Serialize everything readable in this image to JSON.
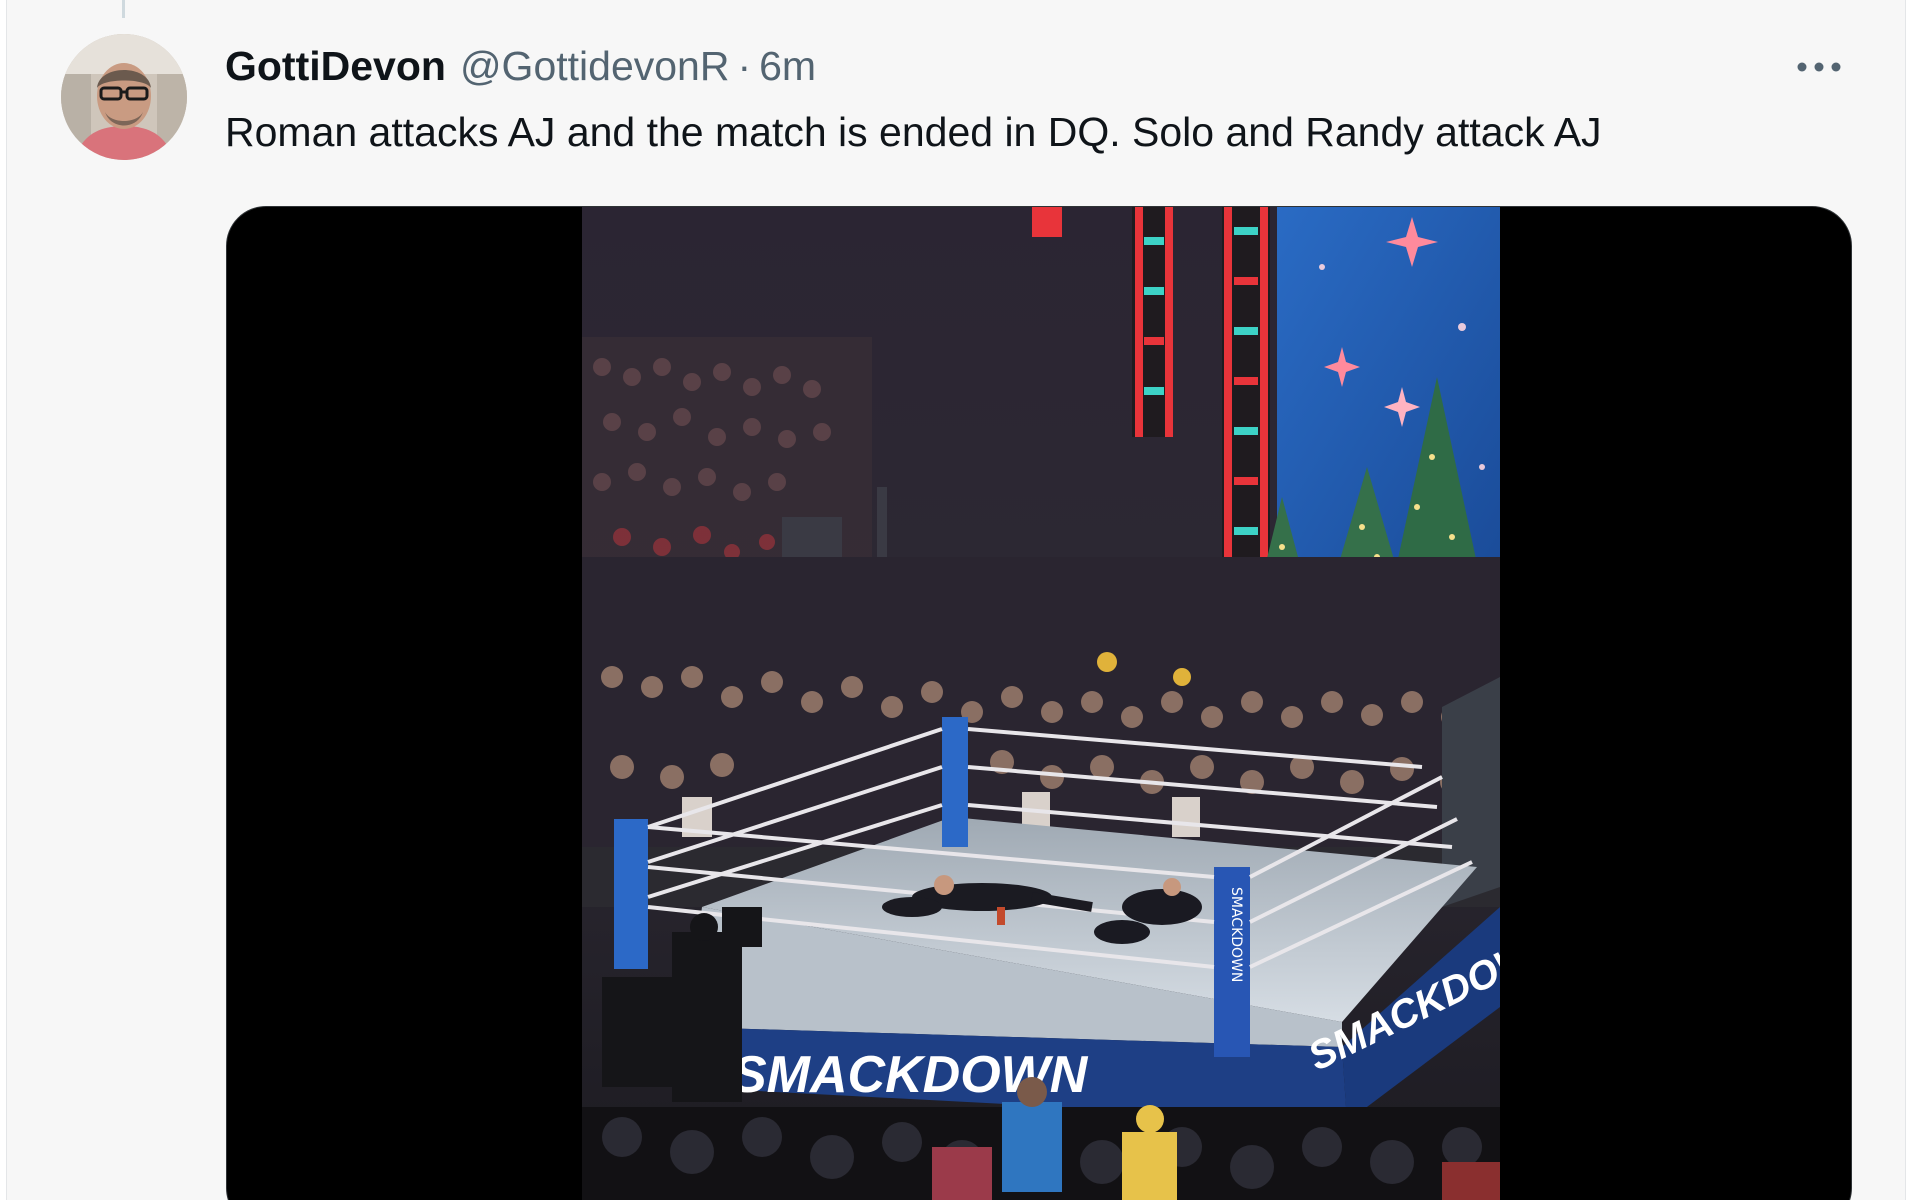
{
  "tweet": {
    "author": {
      "display_name": "GottiDevon",
      "handle": "@GottidevonR",
      "separator": "·",
      "timestamp": "6m"
    },
    "more_icon": "more-horizontal-icon",
    "text": "Roman attacks AJ and the match is ended in DQ. Solo and Randy attack AJ",
    "media": {
      "type": "video",
      "ring_apron_text": "SMACKDOWN",
      "turnbuckle_text": "SMACKDOWN",
      "colors": {
        "letterbox": "#000000",
        "stage_blue": "#1f5fb8",
        "led_red": "#e8343a",
        "mat": "#c9d1db"
      }
    }
  },
  "colors": {
    "name": "#0f1419",
    "secondary": "#536471",
    "background": "#f7f7f7"
  }
}
